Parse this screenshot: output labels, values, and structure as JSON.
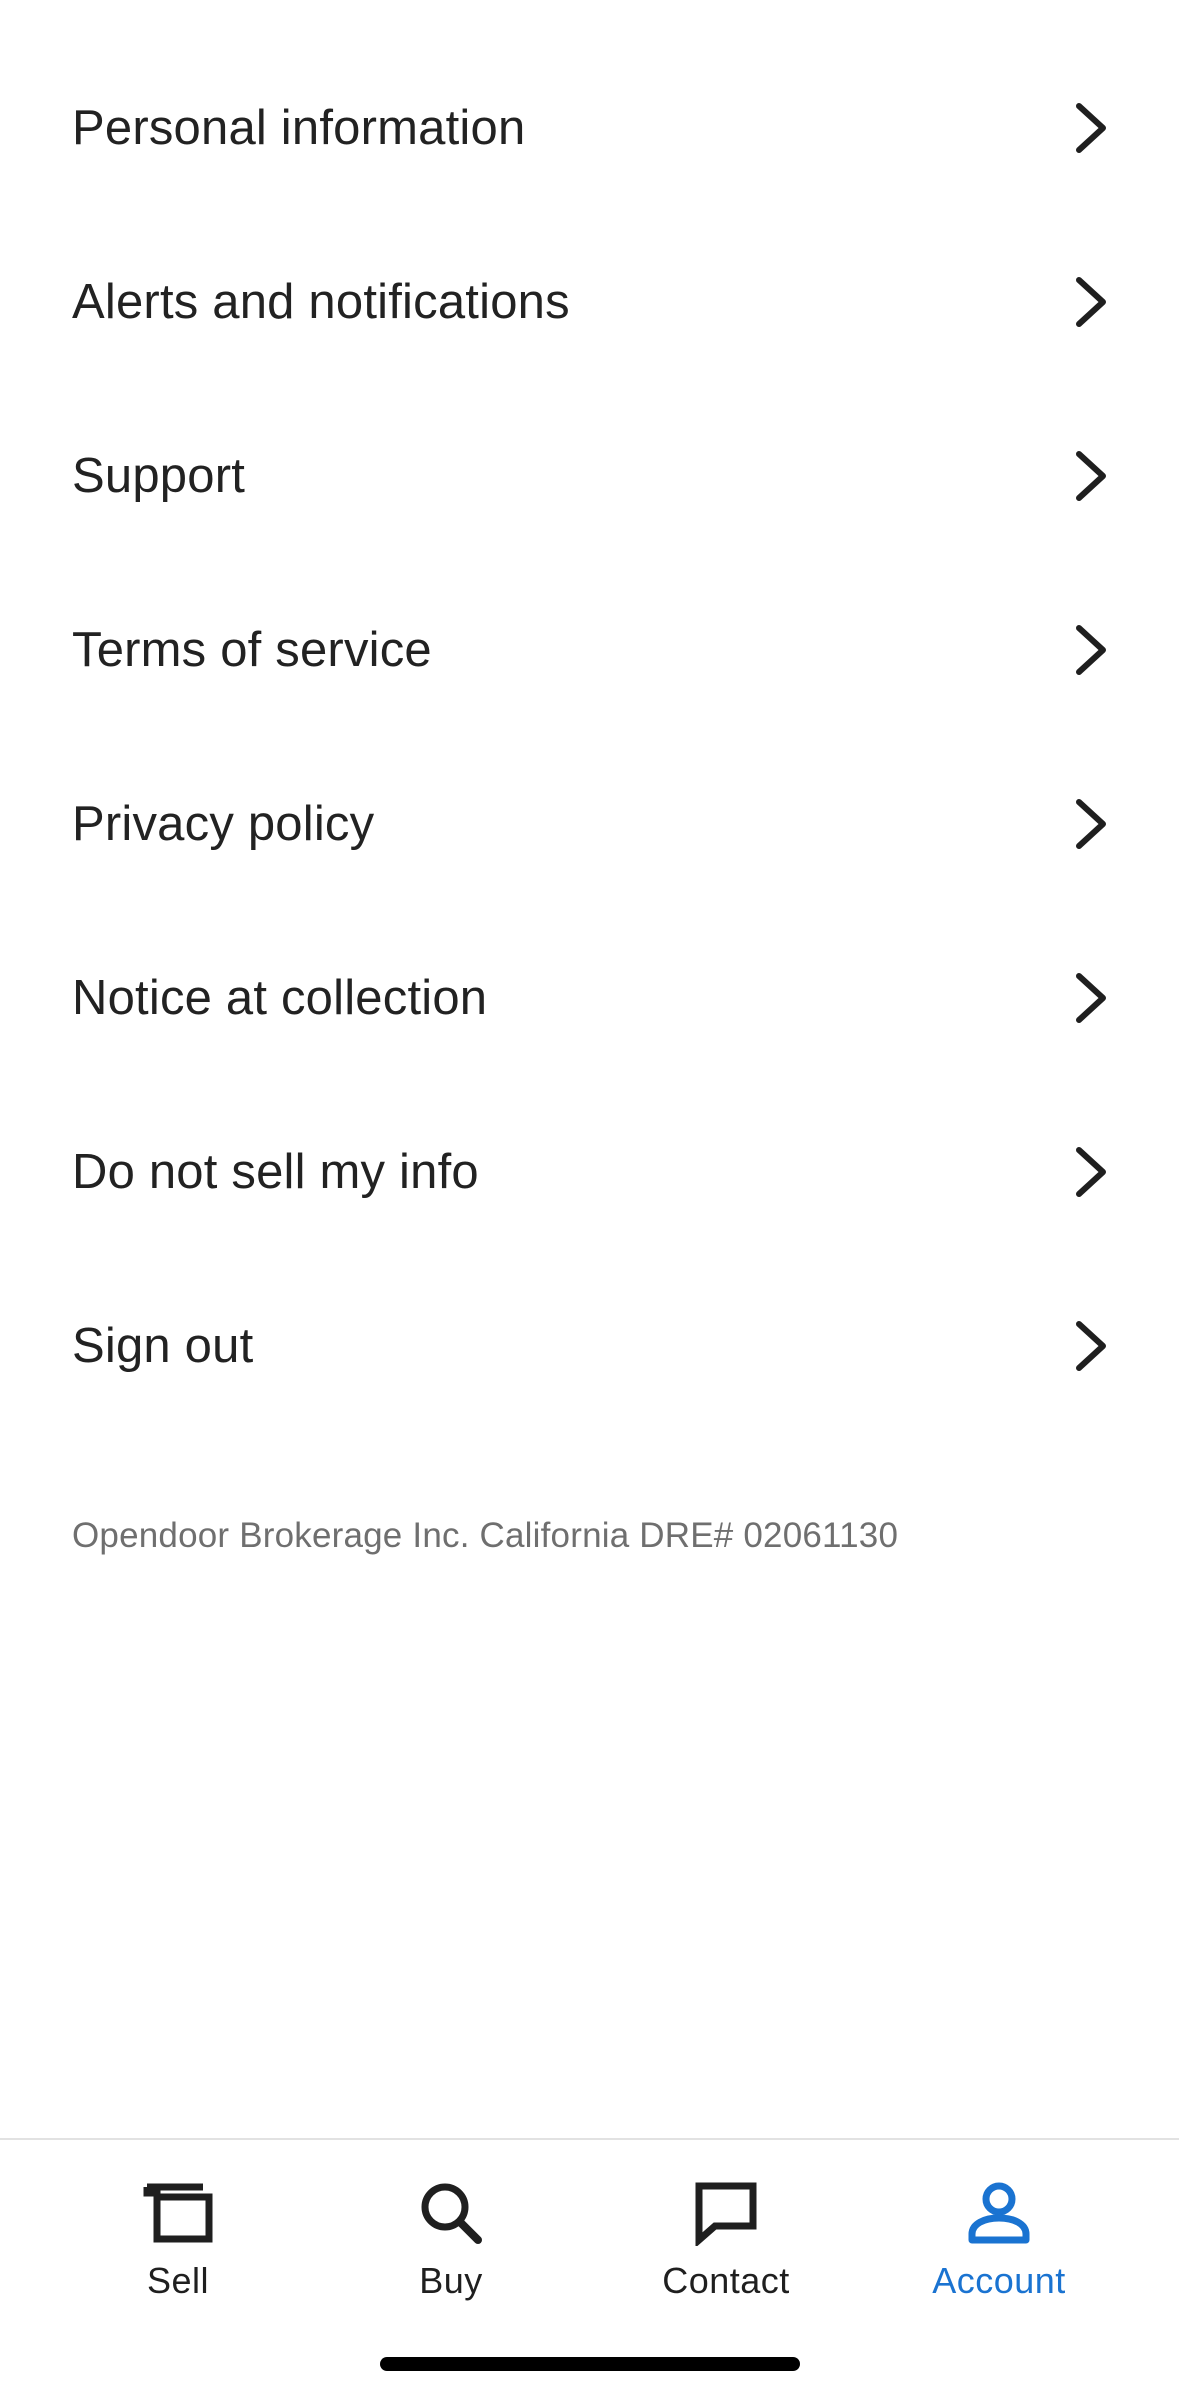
{
  "menu": {
    "items": [
      {
        "label": "Personal information"
      },
      {
        "label": "Alerts and notifications"
      },
      {
        "label": "Support"
      },
      {
        "label": "Terms of service"
      },
      {
        "label": "Privacy policy"
      },
      {
        "label": "Notice at collection"
      },
      {
        "label": "Do not sell my info"
      },
      {
        "label": "Sign out"
      }
    ]
  },
  "footer": {
    "note": "Opendoor Brokerage Inc. California DRE# 02061130"
  },
  "tabbar": {
    "tabs": [
      {
        "label": "Sell",
        "icon": "sell-icon",
        "active": false
      },
      {
        "label": "Buy",
        "icon": "search-icon",
        "active": false
      },
      {
        "label": "Contact",
        "icon": "chat-bubble-icon",
        "active": false
      },
      {
        "label": "Account",
        "icon": "person-icon",
        "active": true
      }
    ]
  },
  "colors": {
    "accent": "#1a73d1",
    "text": "#222222",
    "muted": "#6f6f6f",
    "divider": "#e2e2e2"
  }
}
